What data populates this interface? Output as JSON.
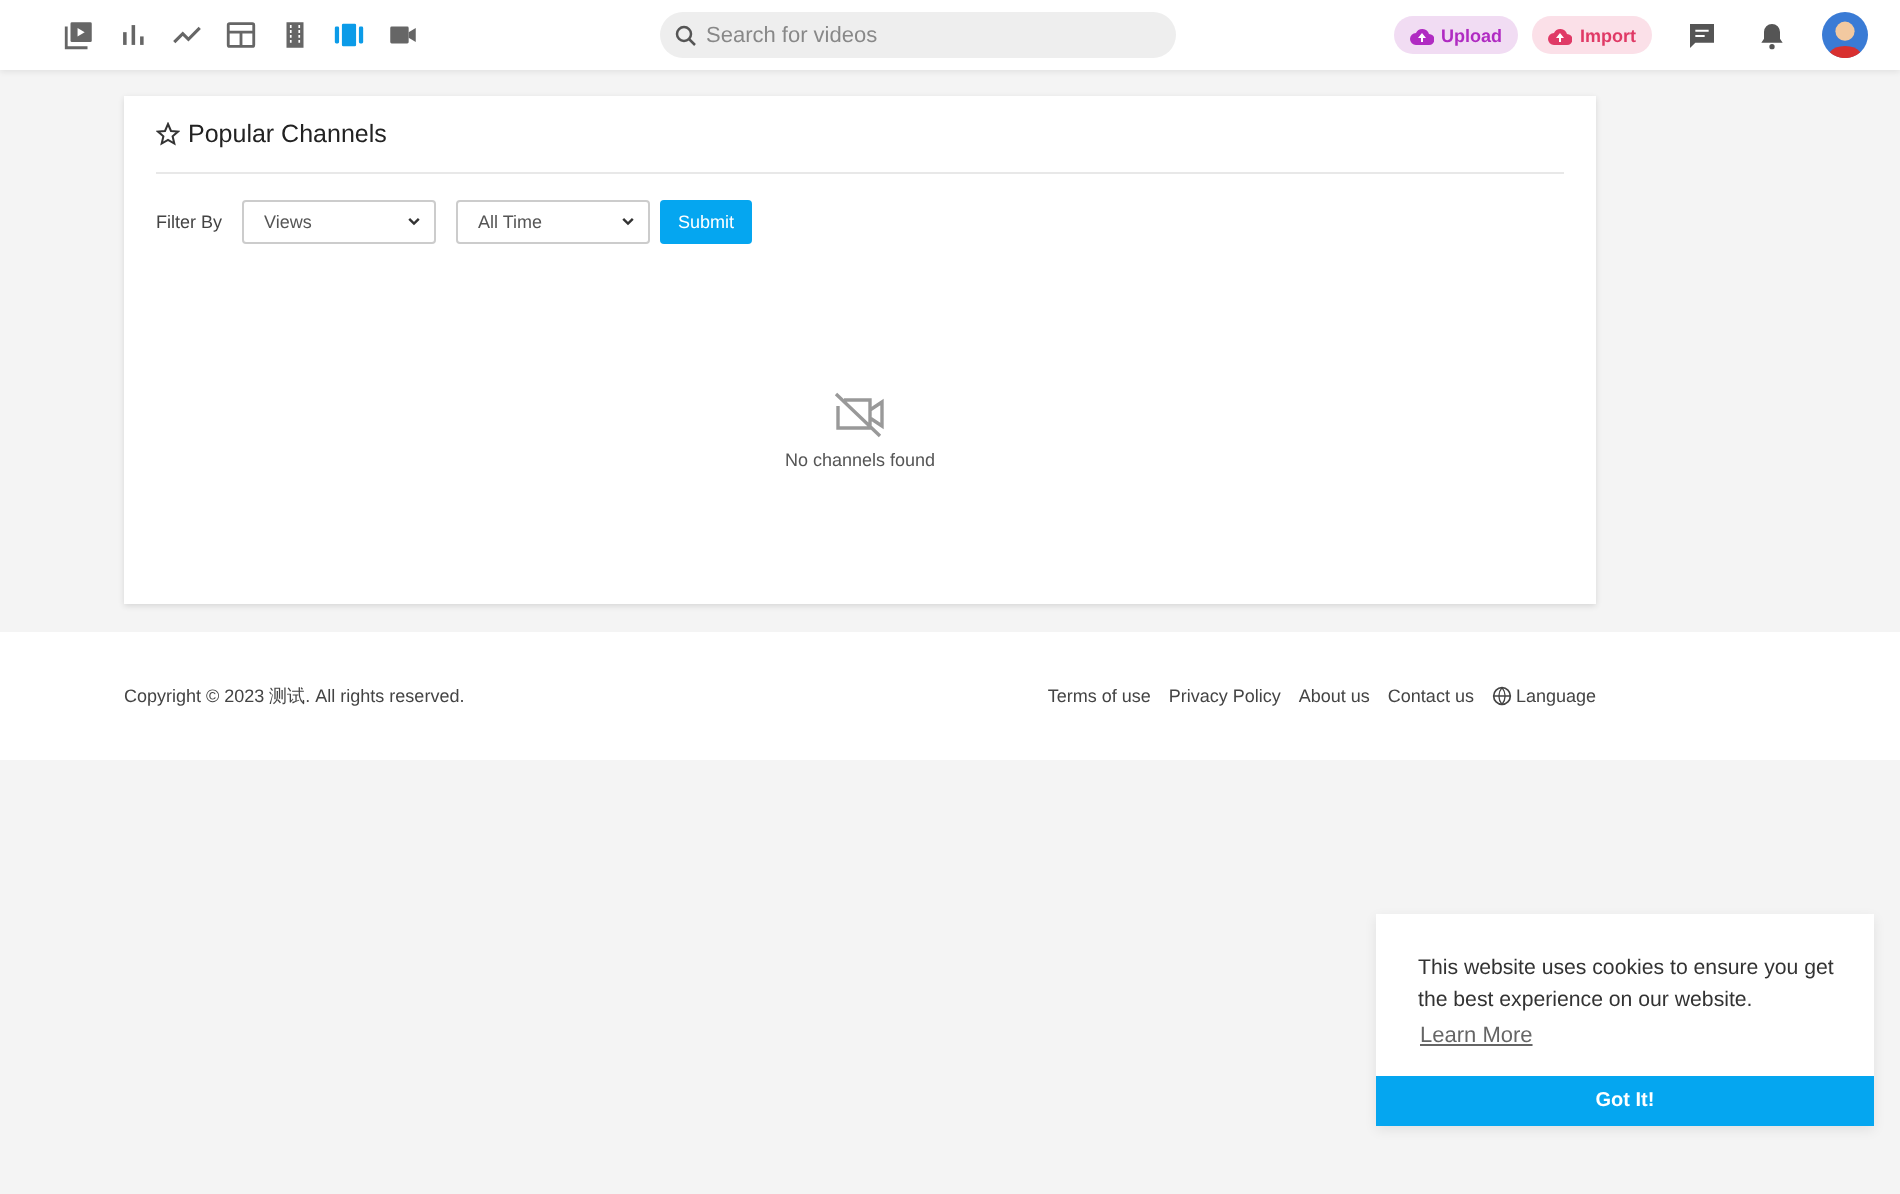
{
  "header": {
    "nav_icons": [
      {
        "selected": false
      },
      {
        "selected": false
      },
      {
        "selected": false
      },
      {
        "selected": false
      },
      {
        "selected": false
      },
      {
        "selected": true
      },
      {
        "selected": false
      }
    ],
    "search": {
      "placeholder": "Search for videos"
    },
    "upload_button": "Upload",
    "import_button": "Import"
  },
  "card": {
    "title": "Popular Channels",
    "filter_label": "Filter By",
    "sort_select": "Views",
    "period_select": "All Time",
    "submit_button": "Submit",
    "empty_message": "No channels found"
  },
  "footer": {
    "copyright": "Copyright © 2023 测试. All rights reserved.",
    "links": [
      "Terms of use",
      "Privacy Policy",
      "About us",
      "Contact us"
    ],
    "language": "Language"
  },
  "cookie_notice": {
    "message": "This website uses cookies to ensure you get the best experience on our website.",
    "learn_more": "Learn More",
    "accept_button": "Got It!"
  }
}
